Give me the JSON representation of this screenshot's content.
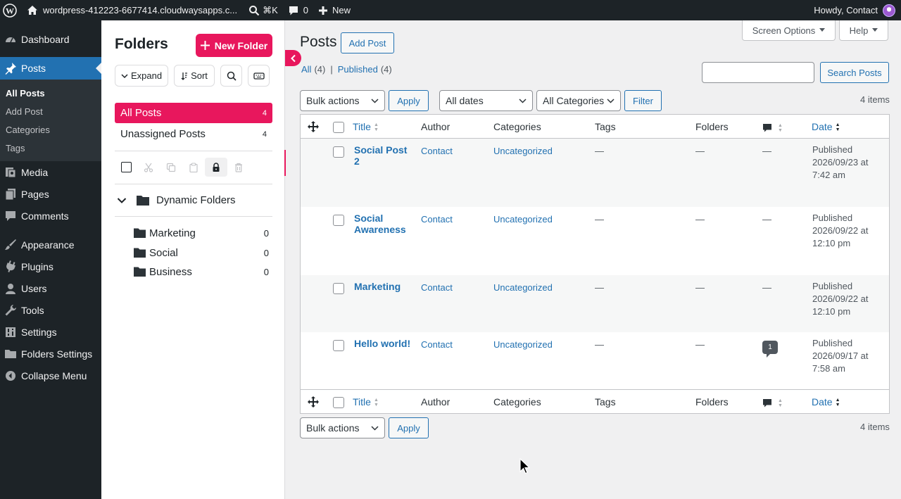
{
  "adminbar": {
    "site_name": "wordpress-412223-6677414.cloudwaysapps.c...",
    "shortcut": "⌘K",
    "comments_count": "0",
    "new_label": "New",
    "howdy": "Howdy, Contact"
  },
  "sidebar": {
    "dashboard": "Dashboard",
    "posts": "Posts",
    "sub": [
      "All Posts",
      "Add Post",
      "Categories",
      "Tags"
    ],
    "media": "Media",
    "pages": "Pages",
    "comments": "Comments",
    "appearance": "Appearance",
    "plugins": "Plugins",
    "users": "Users",
    "tools": "Tools",
    "settings": "Settings",
    "folders_settings": "Folders Settings",
    "collapse": "Collapse Menu"
  },
  "folders": {
    "title": "Folders",
    "new_folder": "New Folder",
    "expand": "Expand",
    "sort": "Sort",
    "all_posts": "All Posts",
    "all_posts_count": "4",
    "unassigned": "Unassigned Posts",
    "unassigned_count": "4",
    "dynamic": "Dynamic Folders",
    "items": [
      {
        "name": "Marketing",
        "count": "0"
      },
      {
        "name": "Social",
        "count": "0"
      },
      {
        "name": "Business",
        "count": "0"
      }
    ]
  },
  "main": {
    "title": "Posts",
    "add_post": "Add Post",
    "screen_options": "Screen Options",
    "help": "Help",
    "view_all": "All",
    "view_all_count": "(4)",
    "view_sep": "|",
    "view_published": "Published",
    "view_published_count": "(4)",
    "search_btn": "Search Posts",
    "bulk_actions": "Bulk actions",
    "apply": "Apply",
    "all_dates": "All dates",
    "all_categories": "All Categories",
    "filter": "Filter",
    "items_count": "4 items",
    "columns": {
      "title": "Title",
      "author": "Author",
      "categories": "Categories",
      "tags": "Tags",
      "folders": "Folders",
      "date": "Date"
    },
    "rows": [
      {
        "title": "Social Post 2",
        "author": "Contact",
        "category": "Uncategorized",
        "tags": "—",
        "folders": "—",
        "comments": "—",
        "date1": "Published",
        "date2": "2026/09/23 at",
        "date3": "7:42 am"
      },
      {
        "title": "Social Awareness",
        "author": "Contact",
        "category": "Uncategorized",
        "tags": "—",
        "folders": "—",
        "comments": "—",
        "date1": "Published",
        "date2": "2026/09/22 at",
        "date3": "12:10 pm"
      },
      {
        "title": "Marketing",
        "author": "Contact",
        "category": "Uncategorized",
        "tags": "—",
        "folders": "—",
        "comments": "—",
        "date1": "Published",
        "date2": "2026/09/22 at",
        "date3": "12:10 pm"
      },
      {
        "title": "Hello world!",
        "author": "Contact",
        "category": "Uncategorized",
        "tags": "—",
        "folders": "—",
        "comments": "1",
        "date1": "Published",
        "date2": "2026/09/17 at",
        "date3": "7:58 am"
      }
    ]
  },
  "colors": {
    "accent_pink": "#e8175d",
    "wp_blue": "#2271b1",
    "admin_dark": "#1d2327"
  }
}
